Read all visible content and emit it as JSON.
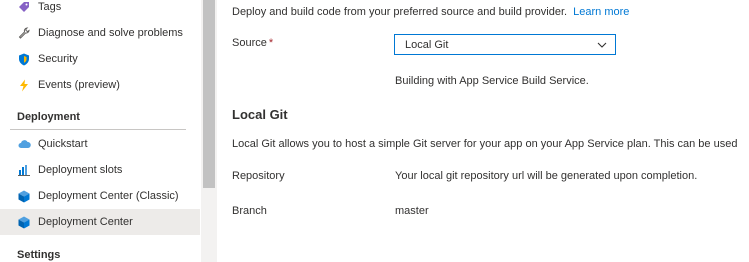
{
  "sidebar": {
    "items_top": [
      {
        "label": "Tags",
        "icon": "tag-icon"
      },
      {
        "label": "Diagnose and solve problems",
        "icon": "wrench-icon"
      },
      {
        "label": "Security",
        "icon": "shield-icon"
      },
      {
        "label": "Events (preview)",
        "icon": "lightning-icon"
      }
    ],
    "deployment_header": "Deployment",
    "deployment_items": [
      {
        "label": "Quickstart",
        "icon": "cloud-icon"
      },
      {
        "label": "Deployment slots",
        "icon": "slots-chart-icon"
      },
      {
        "label": "Deployment Center (Classic)",
        "icon": "cube-icon"
      },
      {
        "label": "Deployment Center",
        "icon": "cube-icon",
        "selected": true
      }
    ],
    "settings_header": "Settings"
  },
  "main": {
    "intro_text": "Deploy and build code from your preferred source and build provider.",
    "learn_more": "Learn more",
    "source_label": "Source",
    "required_mark": "*",
    "source_value": "Local Git",
    "build_service_text": "Building with App Service Build Service.",
    "section_title": "Local Git",
    "section_description": "Local Git allows you to host a simple Git server for your app on your App Service plan. This can be used",
    "repository_label": "Repository",
    "repository_value": "Your local git repository url will be generated upon completion.",
    "branch_label": "Branch",
    "branch_value": "master"
  },
  "colors": {
    "accent": "#0078d4",
    "selected_bg": "#edebe9",
    "required": "#a4262c"
  }
}
